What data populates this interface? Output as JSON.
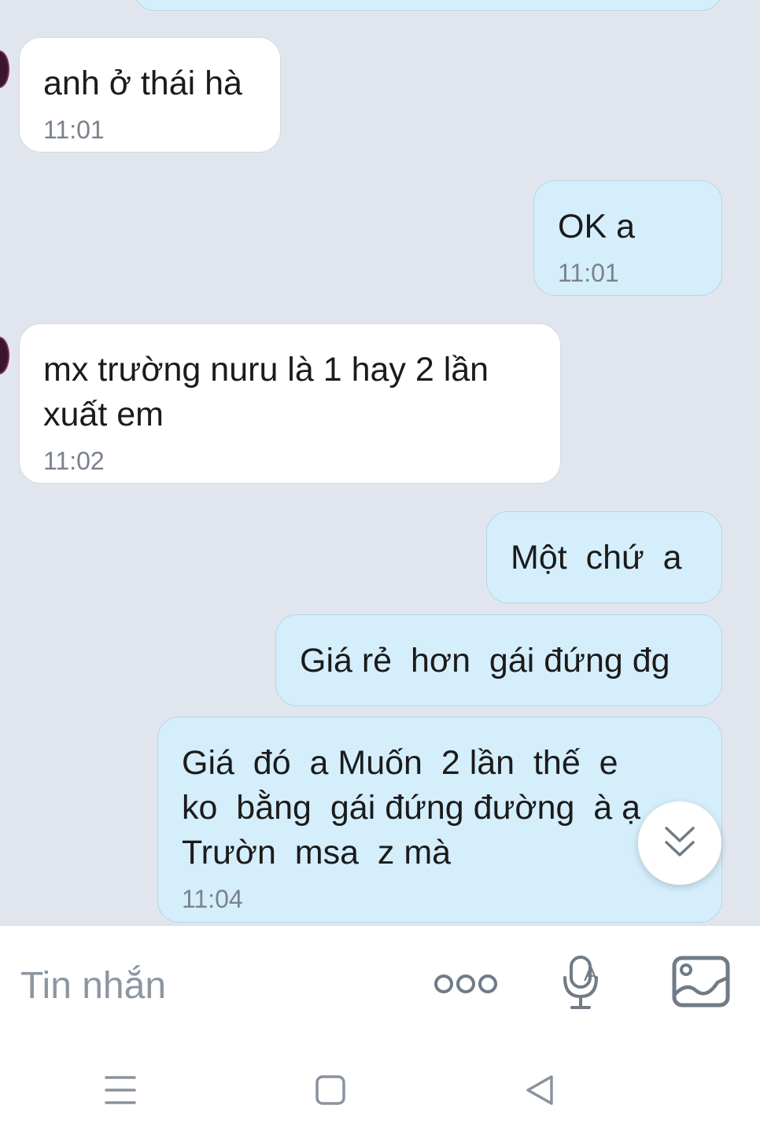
{
  "messages": [
    {
      "direction": "incoming",
      "text": "anh ở thái hà",
      "time": "11:01"
    },
    {
      "direction": "outgoing",
      "text": "OK a",
      "time": "11:01"
    },
    {
      "direction": "incoming",
      "text": "mx trường nuru là 1 hay 2 lần\nxuất em",
      "time": "11:02"
    },
    {
      "direction": "outgoing",
      "text": "Một  chứ  a"
    },
    {
      "direction": "outgoing",
      "text": "Giá rẻ  hơn  gái đứng đg"
    },
    {
      "direction": "outgoing",
      "text": "Giá  đó  a Muốn  2 lần  thế  e\nko  bằng  gái đứng đường  à ạ\nTrườn  msa  z mà",
      "time": "11:04"
    }
  ],
  "composer": {
    "placeholder": "Tin nhắn",
    "icons": [
      "more-icon",
      "voice-to-text-icon",
      "image-icon"
    ]
  },
  "scroll_to_bottom": {
    "icon": "chevron-double-down-icon"
  },
  "navigation_bar": {
    "icons": [
      "recent-apps-icon",
      "home-icon",
      "back-icon"
    ]
  },
  "colors": {
    "chat_background": "#e1e6ee",
    "incoming_bubble": "#ffffff",
    "outgoing_bubble": "#d5eefc",
    "timestamp": "#7a828c",
    "icon": "#707b86"
  }
}
